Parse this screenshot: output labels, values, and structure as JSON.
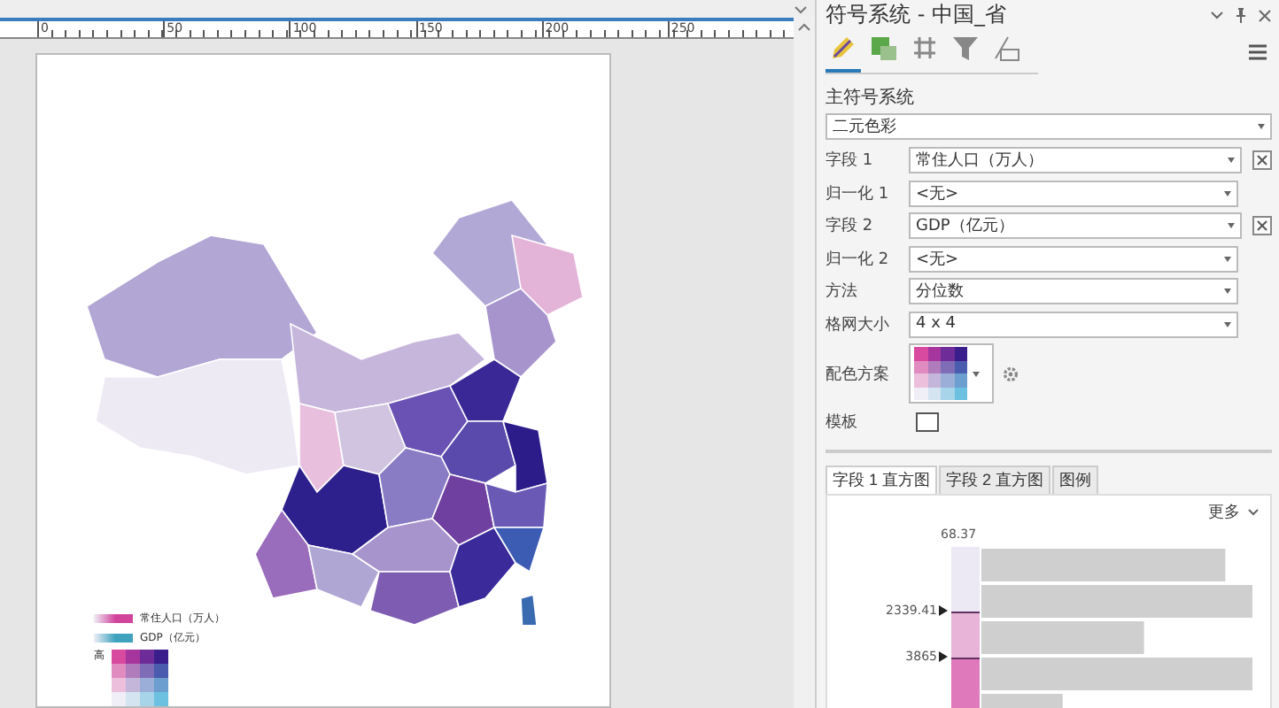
{
  "ruler": {
    "ticks": [
      "0",
      "50",
      "100",
      "150",
      "200",
      "250"
    ]
  },
  "map": {
    "legend": [
      {
        "label": "常住人口（万人）",
        "color": "#d1449c"
      },
      {
        "label": "GDP（亿元）",
        "color": "#3fa3c0"
      }
    ],
    "grid_label": "高"
  },
  "pane": {
    "title": "符号系统 - 中国_省",
    "tools": [
      {
        "selected": true
      },
      {
        "selected": false
      },
      {
        "selected": false
      },
      {
        "selected": false
      },
      {
        "selected": false
      }
    ],
    "section": "主符号系统",
    "type": "二元色彩",
    "rows": [
      {
        "kind": "dropdown",
        "label": "字段 1",
        "value": "常住人口（万人）",
        "clearable": true
      },
      {
        "kind": "dropdown",
        "label": "归一化 1",
        "value": "<无>",
        "clearable": false
      },
      {
        "kind": "dropdown",
        "label": "字段 2",
        "value": "GDP（亿元）",
        "clearable": true
      },
      {
        "kind": "dropdown",
        "label": "归一化 2",
        "value": "<无>",
        "clearable": false
      },
      {
        "kind": "dropdown",
        "label": "方法",
        "value": "分位数",
        "clearable": false
      },
      {
        "kind": "dropdown",
        "label": "格网大小",
        "value": "4 x 4",
        "clearable": false
      },
      {
        "kind": "scheme",
        "label": "配色方案"
      },
      {
        "kind": "checkbox",
        "label": "模板",
        "checked": false
      }
    ],
    "tabs": [
      {
        "label": "字段 1 直方图",
        "selected": true
      },
      {
        "label": "字段 2 直方图",
        "selected": false
      },
      {
        "label": "图例",
        "selected": false
      }
    ],
    "more": "更多",
    "histogram": {
      "top_label": "68.37",
      "breaks": [
        "2339.41",
        "3865"
      ]
    }
  }
}
